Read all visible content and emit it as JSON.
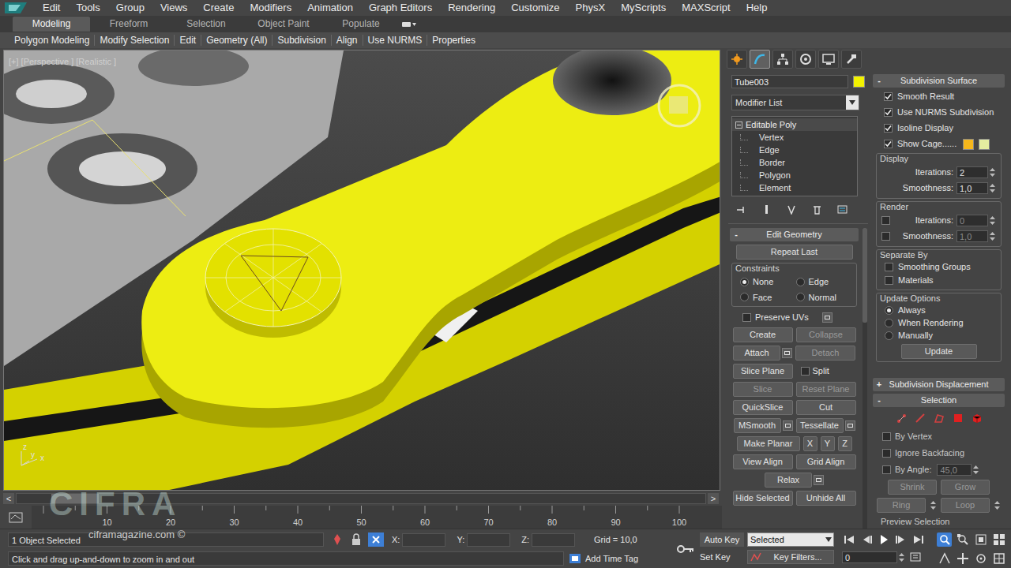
{
  "menu_bar": {
    "items": [
      "Edit",
      "Tools",
      "Group",
      "Views",
      "Create",
      "Modifiers",
      "Animation",
      "Graph Editors",
      "Rendering",
      "Customize",
      "PhysX",
      "MyScripts",
      "MAXScript",
      "Help"
    ]
  },
  "ribbon": {
    "tabs": [
      {
        "label": "Modeling",
        "selected": true
      },
      {
        "label": "Freeform",
        "selected": false
      },
      {
        "label": "Selection",
        "selected": false
      },
      {
        "label": "Object Paint",
        "selected": false
      },
      {
        "label": "Populate",
        "selected": false
      }
    ],
    "panels": [
      "Polygon Modeling",
      "Modify Selection",
      "Edit",
      "Geometry (All)",
      "Subdivision",
      "Align",
      "Use NURMS",
      "Properties"
    ]
  },
  "viewport": {
    "label": "[+] [Perspective ] [Realistic ]",
    "axes": [
      "z",
      "y",
      "x"
    ]
  },
  "watermark": {
    "logo": "CIFRA",
    "site": "ciframagazine.com ©"
  },
  "timeline": {
    "prev": "<",
    "next": ">",
    "ticks": [
      "10",
      "20",
      "30",
      "40",
      "50",
      "60",
      "70",
      "80",
      "90",
      "100"
    ]
  },
  "command_panel": {
    "tabs": [
      {
        "selected": false
      },
      {
        "selected": true
      },
      {
        "selected": false
      },
      {
        "selected": false
      },
      {
        "selected": false
      },
      {
        "selected": false
      }
    ],
    "object_name": "Tube003",
    "object_color": "#f2f200",
    "modifier_list": "Modifier List",
    "stack": {
      "label": "Editable Poly",
      "expanded": true,
      "items": [
        "Vertex",
        "Edge",
        "Border",
        "Polygon",
        "Element"
      ]
    },
    "edit_geometry": {
      "collapse": "-",
      "title": "Edit Geometry",
      "repeat_last": "Repeat Last",
      "constraints": {
        "title": "Constraints",
        "options": [
          {
            "label": "None",
            "selected": true
          },
          {
            "label": "Edge",
            "selected": false
          },
          {
            "label": "Face",
            "selected": false
          },
          {
            "label": "Normal",
            "selected": false
          }
        ]
      },
      "preserve_uvs": {
        "label": "Preserve UVs",
        "checked": false
      },
      "rows": [
        [
          {
            "kind": "button",
            "label": "Create",
            "disabled": false
          },
          {
            "kind": "button",
            "label": "Collapse",
            "disabled": true
          }
        ],
        [
          {
            "kind": "settings",
            "label": "Attach",
            "disabled": false
          },
          {
            "kind": "button",
            "label": "Detach",
            "disabled": true
          }
        ],
        [
          {
            "kind": "button",
            "label": "Slice Plane",
            "disabled": false
          },
          {
            "kind": "checkbox",
            "label": "Split",
            "checked": false,
            "disabled": false
          }
        ],
        [
          {
            "kind": "button",
            "label": "Slice",
            "disabled": true
          },
          {
            "kind": "button",
            "label": "Reset Plane",
            "disabled": true
          }
        ],
        [
          {
            "kind": "button",
            "label": "QuickSlice",
            "disabled": false
          },
          {
            "kind": "button",
            "label": "Cut",
            "disabled": false
          }
        ],
        [
          {
            "kind": "settings",
            "label": "MSmooth",
            "disabled": false
          },
          {
            "kind": "settings",
            "label": "Tessellate",
            "disabled": false
          }
        ],
        [
          {
            "kind": "button",
            "label": "Make Planar",
            "disabled": false
          },
          {
            "kind": "small",
            "label": "X",
            "disabled": false
          },
          {
            "kind": "small",
            "label": "Y",
            "disabled": false
          },
          {
            "kind": "small",
            "label": "Z",
            "disabled": false
          }
        ],
        [
          {
            "kind": "button",
            "label": "View Align",
            "disabled": false
          },
          {
            "kind": "button",
            "label": "Grid Align",
            "disabled": false
          }
        ],
        [
          {
            "kind": "settings",
            "label": "Relax",
            "disabled": false
          }
        ],
        [
          {
            "kind": "button",
            "label": "Hide Selected",
            "disabled": false
          },
          {
            "kind": "button",
            "label": "Unhide All",
            "disabled": false
          }
        ]
      ]
    }
  },
  "subdivision_surface": {
    "collapse": "-",
    "title": "Subdivision Surface",
    "checks": [
      {
        "label": "Smooth Result",
        "checked": true
      },
      {
        "label": "Use NURMS Subdivision",
        "checked": true
      },
      {
        "label": "Isoline Display",
        "checked": true
      },
      {
        "label": "Show Cage......",
        "checked": true
      }
    ],
    "cage_colors": [
      "#f5b71c",
      "#e4eca0"
    ],
    "display": {
      "title": "Display",
      "fields": [
        {
          "label": "Iterations:",
          "value": "2"
        },
        {
          "label": "Smoothness:",
          "value": "1,0"
        }
      ]
    },
    "render": {
      "title": "Render",
      "fields": [
        {
          "label": "Iterations:",
          "value": "0",
          "checked": false
        },
        {
          "label": "Smoothness:",
          "value": "1,0",
          "checked": false
        }
      ]
    },
    "separate_by": {
      "title": "Separate By",
      "checks": [
        {
          "label": "Smoothing Groups",
          "checked": false
        },
        {
          "label": "Materials",
          "checked": false
        }
      ]
    },
    "update_options": {
      "title": "Update Options",
      "options": [
        {
          "label": "Always",
          "selected": true
        },
        {
          "label": "When Rendering",
          "selected": false
        },
        {
          "label": "Manually",
          "selected": false
        }
      ]
    },
    "update": "Update"
  },
  "subdivision_displacement": {
    "collapse": "+",
    "title": "Subdivision Displacement"
  },
  "selection": {
    "collapse": "-",
    "title": "Selection",
    "levels": [
      {
        "selected": false
      },
      {
        "selected": false
      },
      {
        "selected": false
      },
      {
        "selected": false
      },
      {
        "selected": false
      }
    ],
    "checks": [
      {
        "label": "By Vertex",
        "checked": false
      },
      {
        "label": "Ignore Backfacing",
        "checked": false
      },
      {
        "label": "By Angle:",
        "checked": false
      }
    ],
    "angle": "45,0",
    "rows": [
      [
        {
          "label": "Shrink"
        },
        {
          "label": "Grow"
        }
      ],
      [
        {
          "label": "Ring"
        },
        {
          "label": "Loop"
        }
      ]
    ],
    "preview": "Preview Selection"
  },
  "status_bar": {
    "selection": "1 Object Selected",
    "prompt": "Click and drag up-and-down to zoom in and out",
    "absolute_mode": true,
    "coords": [
      {
        "label": "X:",
        "value": ""
      },
      {
        "label": "Y:",
        "value": ""
      },
      {
        "label": "Z:",
        "value": ""
      }
    ],
    "grid": "Grid = 10,0",
    "add_time_tag": "Add Time Tag",
    "auto_key": {
      "label": "Auto Key",
      "on": false
    },
    "set_key": "Set Key",
    "key_mode": "Selected",
    "key_filters": "Key Filters...",
    "frame": "0",
    "nav_tools": [
      {
        "selected": true
      },
      {
        "selected": false
      },
      {
        "selected": false
      },
      {
        "selected": false
      },
      {
        "selected": false
      },
      {
        "selected": false
      },
      {
        "selected": false
      },
      {
        "selected": false
      }
    ]
  }
}
